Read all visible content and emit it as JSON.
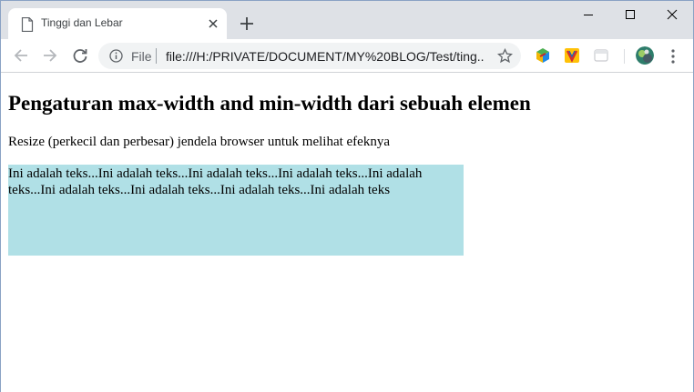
{
  "browser": {
    "tab": {
      "title": "Tinggi dan Lebar"
    },
    "address_bar": {
      "scheme_label": "File",
      "url": "file:///H:/PRIVATE/DOCUMENT/MY%20BLOG/Test/ting..."
    },
    "icons": {
      "page": "page-icon",
      "close": "close-icon",
      "new_tab": "plus-icon",
      "minimize": "minimize-icon",
      "maximize": "maximize-icon",
      "window_close": "window-close-icon",
      "back": "back-arrow-icon",
      "forward": "forward-arrow-icon",
      "reload": "reload-icon",
      "info": "info-icon",
      "bookmark": "star-icon",
      "menu": "kebab-menu-icon"
    },
    "colors": {
      "tabstrip": "#dee1e6",
      "omnibox": "#f1f3f4",
      "border": "#8aa2c4"
    }
  },
  "page": {
    "heading": "Pengaturan max-width and min-width dari sebuah elemen",
    "paragraph": "Resize (perkecil dan perbesar) jendela browser untuk melihat efeknya",
    "box_text": "Ini adalah teks...Ini adalah teks...Ini adalah teks...Ini adalah teks...Ini adalah teks...Ini adalah teks...Ini adalah teks...Ini adalah teks...Ini adalah teks",
    "box_color": "#b0e0e6"
  }
}
